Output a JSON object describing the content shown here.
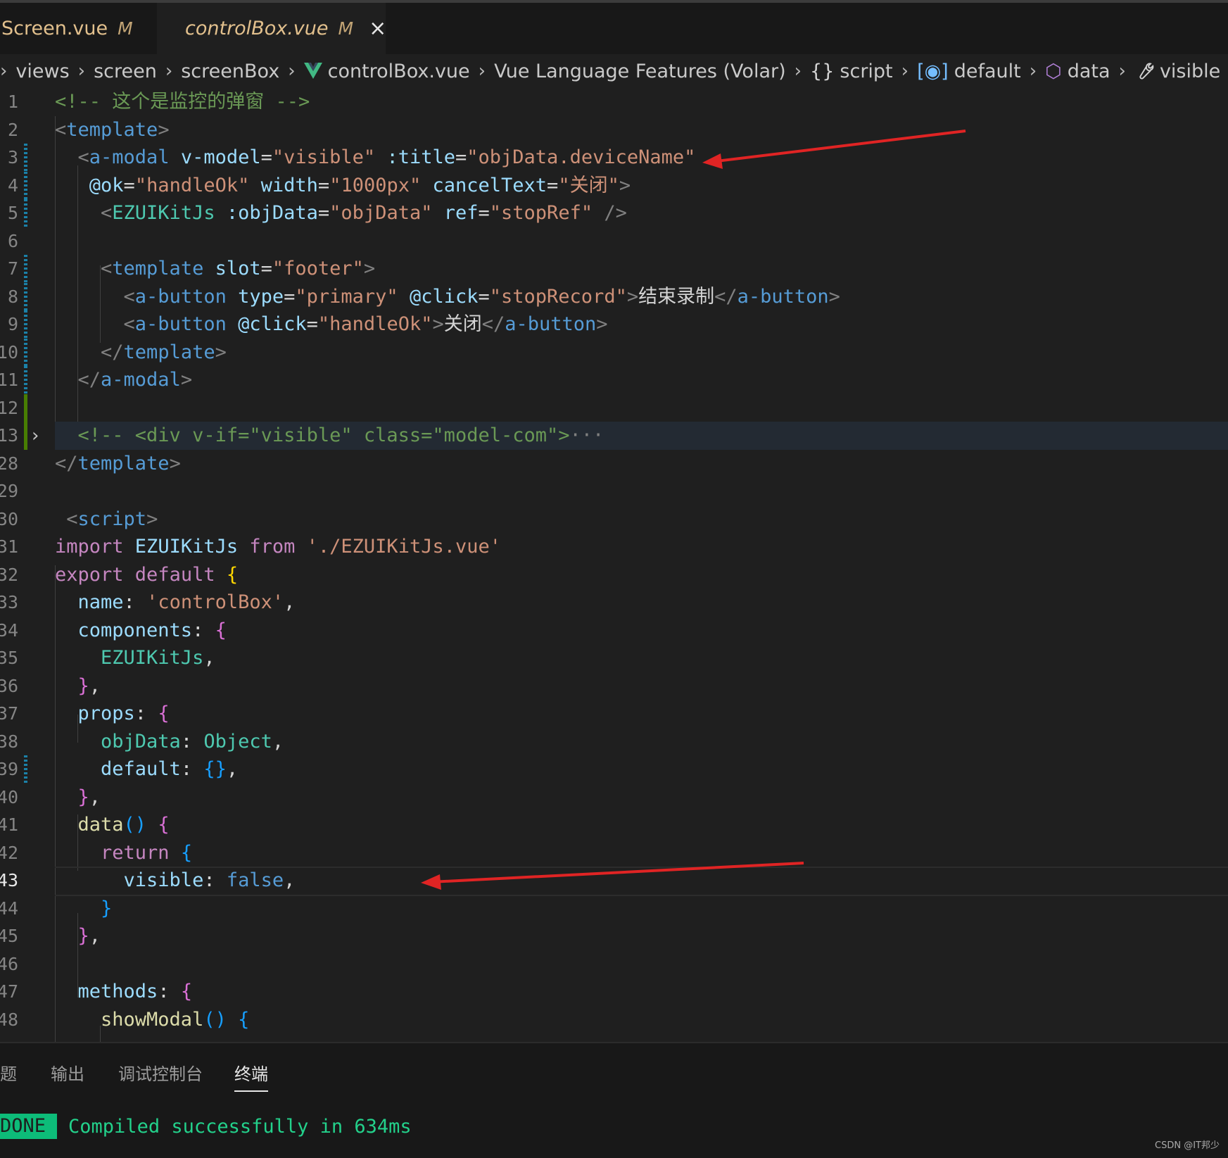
{
  "tabs": [
    {
      "label": "Screen.vue",
      "status": "M"
    },
    {
      "label": "controlBox.vue",
      "status": "M",
      "close": "×"
    }
  ],
  "breadcrumb": {
    "lead": "›",
    "parts": [
      "views",
      "screen",
      "screenBox",
      "controlBox.vue",
      "Vue Language Features (Volar)",
      "script",
      "default",
      "data",
      "visible"
    ],
    "icons": {
      "script": "{}",
      "default": "[◉]",
      "data": "⬡",
      "visible": "🔧"
    }
  },
  "code": {
    "l1": {
      "n": "1",
      "a": "<!-- 这个是监控的弹窗 -->"
    },
    "l2": {
      "n": "2",
      "a": "<",
      "b": "template",
      "c": ">"
    },
    "l3": {
      "n": "3",
      "a": "  <",
      "b": "a-modal",
      "c": " v-model",
      "d": "=",
      "e": "\"visible\"",
      "f": " :title",
      "g": "=",
      "h": "\"objData.deviceName\""
    },
    "l4": {
      "n": "4",
      "a": "   @ok",
      "b": "=",
      "c": "\"handleOk\"",
      "d": " width",
      "e": "=",
      "f": "\"1000px\"",
      "g": " cancelText",
      "h": "=",
      "i": "\"关闭\"",
      "j": ">"
    },
    "l5": {
      "n": "5",
      "a": "    <",
      "b": "EZUIKitJs",
      "c": " :objData",
      "d": "=",
      "e": "\"objData\"",
      "f": " ref",
      "g": "=",
      "h": "\"stopRef\"",
      "i": " />"
    },
    "l6": {
      "n": "6"
    },
    "l7": {
      "n": "7",
      "a": "    <",
      "b": "template",
      "c": " slot",
      "d": "=",
      "e": "\"footer\"",
      "f": ">"
    },
    "l8": {
      "n": "8",
      "a": "      <",
      "b": "a-button",
      "c": " type",
      "d": "=",
      "e": "\"primary\"",
      "f": " @click",
      "g": "=",
      "h": "\"stopRecord\"",
      "i": ">",
      "j": "结束录制",
      "k": "</",
      "l": "a-button",
      "m": ">"
    },
    "l9": {
      "n": "9",
      "a": "      <",
      "b": "a-button",
      "c": " @click",
      "d": "=",
      "e": "\"handleOk\"",
      "f": ">",
      "g": "关闭",
      "h": "</",
      "i": "a-button",
      "j": ">"
    },
    "l10": {
      "n": "10",
      "a": "    </",
      "b": "template",
      "c": ">"
    },
    "l11": {
      "n": "11",
      "a": "  </",
      "b": "a-modal",
      "c": ">"
    },
    "l12": {
      "n": "12"
    },
    "l13": {
      "n": "13",
      "a": "  <!-- <div v-if=\"visible\" class=\"model-com\">",
      "b": "···"
    },
    "l28": {
      "n": "28",
      "a": "</",
      "b": "template",
      "c": ">"
    },
    "l29": {
      "n": "29"
    },
    "l30": {
      "n": "30",
      "a": " <",
      "b": "script",
      "c": ">"
    },
    "l31": {
      "n": "31",
      "a": "import",
      "b": " EZUIKitJs ",
      "c": "from",
      "d": " './EZUIKitJs.vue'"
    },
    "l32": {
      "n": "32",
      "a": "export",
      "b": " default ",
      "c": "{"
    },
    "l33": {
      "n": "33",
      "a": "  name",
      "b": ": ",
      "c": "'controlBox'",
      "d": ","
    },
    "l34": {
      "n": "34",
      "a": "  components",
      "b": ": ",
      "c": "{"
    },
    "l35": {
      "n": "35",
      "a": "    EZUIKitJs",
      "b": ","
    },
    "l36": {
      "n": "36",
      "a": "  }",
      "b": ","
    },
    "l37": {
      "n": "37",
      "a": "  props",
      "b": ": ",
      "c": "{"
    },
    "l38": {
      "n": "38",
      "a": "    objData",
      "b": ": ",
      "c": "Object",
      "d": ","
    },
    "l39": {
      "n": "39",
      "a": "    default",
      "b": ": ",
      "c": "{}",
      "d": ","
    },
    "l40": {
      "n": "40",
      "a": "  }",
      "b": ","
    },
    "l41": {
      "n": "41",
      "a": "  data",
      "b": "()",
      "c": " ",
      "d": "{"
    },
    "l42": {
      "n": "42",
      "a": "    return",
      "b": " ",
      "c": "{"
    },
    "l43": {
      "n": "43",
      "a": "      visible",
      "b": ": ",
      "c": "false",
      "d": ","
    },
    "l44": {
      "n": "44",
      "a": "    }"
    },
    "l45": {
      "n": "45",
      "a": "  }",
      "b": ","
    },
    "l46": {
      "n": "46"
    },
    "l47": {
      "n": "47",
      "a": "  methods",
      "b": ": ",
      "c": "{"
    },
    "l48": {
      "n": "48",
      "a": "    showModal",
      "b": "()",
      "c": " ",
      "d": "{"
    }
  },
  "panel": {
    "tabs": [
      "题",
      "输出",
      "调试控制台",
      "终端"
    ],
    "active_tab": "终端",
    "badge": "DONE",
    "message": "Compiled successfully in 634ms"
  },
  "watermark": "CSDN @IT邦少",
  "colors": {
    "arrow": "#e02424",
    "modified": "#e2c08d",
    "added": "#487e02",
    "done": "#0dbc79"
  }
}
